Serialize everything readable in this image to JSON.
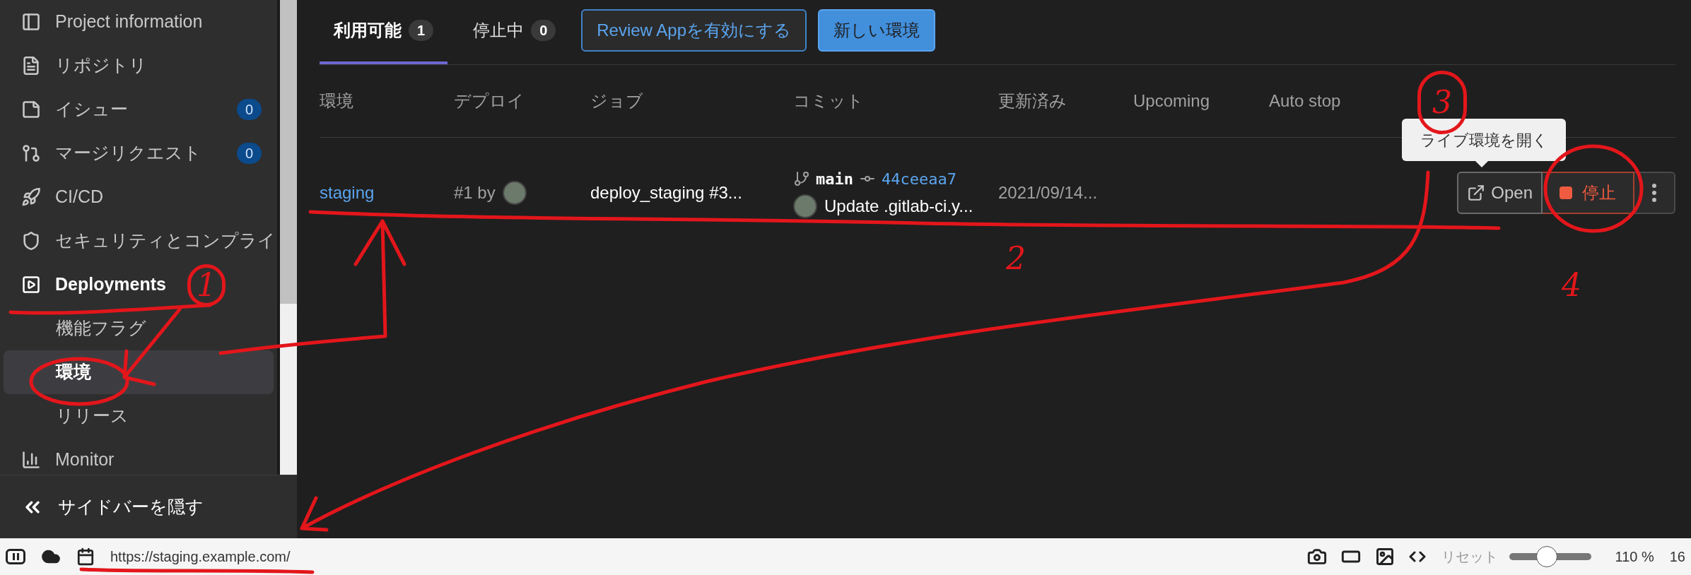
{
  "sidebar": {
    "items": [
      {
        "label": "Project information",
        "active": false
      },
      {
        "label": "リポジトリ",
        "active": false
      },
      {
        "label": "イシュー",
        "badge": "0",
        "active": false
      },
      {
        "label": "マージリクエスト",
        "badge": "0",
        "active": false
      },
      {
        "label": "CI/CD",
        "active": false
      },
      {
        "label": "セキュリティとコンプライ",
        "active": false
      },
      {
        "label": "Deployments",
        "active": true,
        "children": [
          {
            "label": "機能フラグ",
            "selected": false
          },
          {
            "label": "環境",
            "selected": true
          },
          {
            "label": "リリース",
            "selected": false
          }
        ]
      },
      {
        "label": "Monitor",
        "active": false
      }
    ],
    "collapse_label": "サイドバーを隠す"
  },
  "tabs": [
    {
      "label": "利用可能",
      "count": "1",
      "selected": true
    },
    {
      "label": "停止中",
      "count": "0",
      "selected": false
    }
  ],
  "buttons": [
    {
      "label": "Review Appを有効にする",
      "kind": "outline"
    },
    {
      "label": "新しい環境",
      "kind": "primary"
    }
  ],
  "table": {
    "columns": [
      "環境",
      "デプロイ",
      "ジョブ",
      "コミット",
      "更新済み",
      "Upcoming",
      "Auto stop"
    ],
    "rows": [
      {
        "environment": "staging",
        "deploy": "#1 by",
        "job": "deploy_staging #3...",
        "commit": {
          "branch": "main",
          "sha": "44ceeaa7",
          "message": "Update .gitlab-ci.y..."
        },
        "updated": "2021/09/14...",
        "actions": {
          "open": "Open",
          "stop": "停止"
        }
      }
    ]
  },
  "tooltip": "ライブ環境を開く",
  "status_bar": {
    "url": "https://staging.example.com/",
    "reset": "リセット",
    "zoom": {
      "level": 0.45
    },
    "zoom_reading": "110 %",
    "trailing": "16"
  },
  "annotations": [
    {
      "label": "1",
      "circled": true
    },
    {
      "label": "2",
      "circled": false
    },
    {
      "label": "3",
      "circled": true
    },
    {
      "label": "4",
      "circled": false
    }
  ]
}
